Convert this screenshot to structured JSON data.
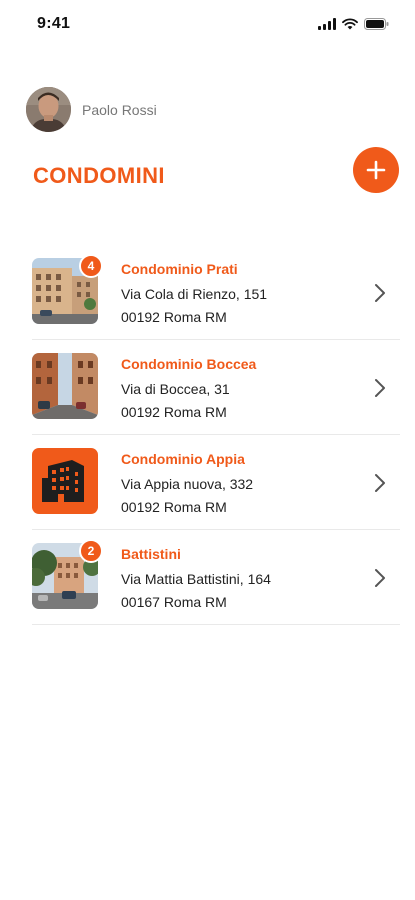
{
  "status_bar": {
    "time": "9:41",
    "icons": [
      "signal-icon",
      "wifi-icon",
      "battery-icon"
    ]
  },
  "profile": {
    "name": "Paolo Rossi",
    "avatar_icon": "avatar-icon"
  },
  "header": {
    "title": "CONDOMINI",
    "add_icon": "plus-icon"
  },
  "colors": {
    "accent": "#f05a1a",
    "text": "#222222",
    "muted": "#777777",
    "divider": "#e9e9e9"
  },
  "condomini": [
    {
      "name": "Condominio Prati",
      "address": "Via Cola di Rienzo, 151",
      "city": "00192 Roma RM",
      "badge": "4",
      "chevron_icon": "chevron-right-icon"
    },
    {
      "name": "Condominio Boccea",
      "address": "Via di Boccea, 31",
      "city": "00192 Roma RM",
      "badge": "",
      "chevron_icon": "chevron-right-icon"
    },
    {
      "name": "Condominio Appia",
      "address": "Via Appia nuova, 332",
      "city": "00192 Roma RM",
      "badge": "",
      "chevron_icon": "chevron-right-icon"
    },
    {
      "name": "Battistini",
      "address": "Via Mattia Battistini, 164",
      "city": "00167 Roma RM",
      "badge": "2",
      "chevron_icon": "chevron-right-icon"
    }
  ]
}
